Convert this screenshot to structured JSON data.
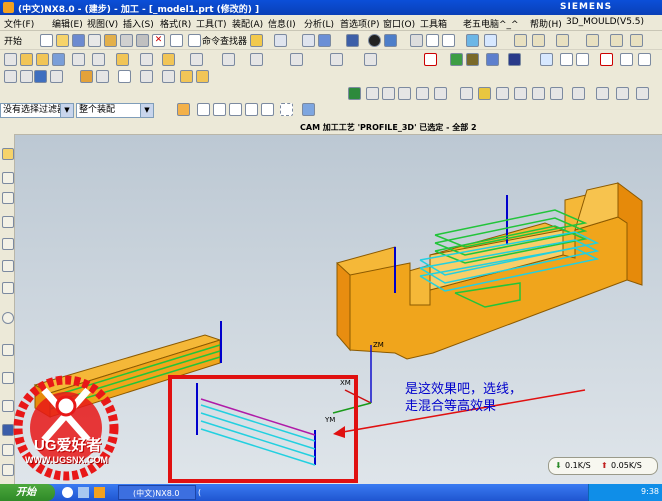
{
  "window": {
    "title": "(中文)NX8.0  - (建步) - 加工 - [_model1.prt  (修改的) ]",
    "brand": "SIEMENS"
  },
  "menu": {
    "items": [
      "开始",
      "文件(F)",
      "编辑(E)",
      "视图(V)",
      "插入(S)",
      "格式(R)",
      "工具(T)",
      "装配(A)",
      "信息(I)",
      "分析(L)",
      "首选项(P)",
      "窗口(O)",
      "工具箱",
      "老五电脑^_^",
      "帮助(H)",
      "3D_MOULD(V5.5)"
    ]
  },
  "toolbar1": {
    "start_label": "开始",
    "command_finder": "命令查找器"
  },
  "filterbar": {
    "selection_filter": "没有选择过滤器",
    "assembly_scope": "整个装配"
  },
  "statusline": {
    "text": "CAM 加工工艺 'PROFILE_3D' 已选定 - 全部 2"
  },
  "viewport": {
    "annotation_line1": "是这效果吧，选线，",
    "annotation_line2": "走混合等高效果",
    "axis": {
      "z": "ZM",
      "x": "XM",
      "y": "YM"
    }
  },
  "watermark": {
    "title": "UG爱好者",
    "url": "WWW.UGSNX.COM"
  },
  "netmeter": {
    "down": "0.1K/S",
    "up": "0.05K/S"
  },
  "taskbar": {
    "start": "开始",
    "item1": "(中文)NX8.0",
    "item2": "(",
    "clock": "9:38"
  },
  "colors": {
    "titlebar": "#0b4fd8",
    "part_orange": "#f2a21a",
    "toolpath_cyan": "#22d0e0",
    "toolpath_green": "#22c43a",
    "annotation_box": "#e01010"
  }
}
